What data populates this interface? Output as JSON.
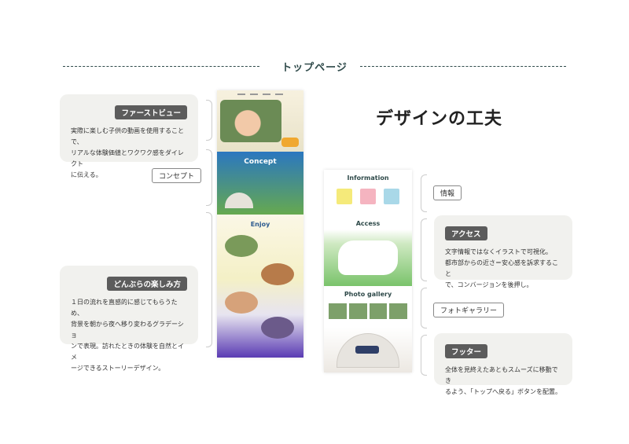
{
  "header": {
    "title": "トップページ"
  },
  "design_title": "デザインの工夫",
  "sections": {
    "first_view": {
      "tag": "ファーストビュー",
      "desc": [
        "実際に楽しむ子供の動画を使用することで、",
        "リアルな体験価値とワクワク感をダイレクト",
        "に伝える。"
      ]
    },
    "concept": {
      "tag": "コンセプト"
    },
    "enjoy": {
      "tag": "どんぶらの楽しみ方",
      "desc": [
        "１日の流れを直感的に感じてもらうため、",
        "背景を朝から夜へ移り変わるグラデーショ",
        "ンで表現。訪れたときの体験を自然とイメ",
        "ージできるストーリーデザイン。"
      ]
    },
    "info": {
      "tag": "情報"
    },
    "access": {
      "tag": "アクセス",
      "desc": [
        "文字情報ではなくイラストで可視化。",
        "都市部からの近さ＝安心感を訴求すること",
        "で、コンバージョンを後押し。"
      ]
    },
    "gallery": {
      "tag": "フォトギャラリー"
    },
    "footer": {
      "tag": "フッター",
      "desc": [
        "全体を見終えたあともスムーズに移動でき",
        "るよう、「トップへ戻る」ボタンを配置。"
      ]
    }
  },
  "mockup": {
    "concept_label": "Concept",
    "enjoy_label": "Enjoy",
    "info_label": "Information",
    "access_label": "Access",
    "gallery_label": "Photo gallery"
  },
  "colors": {
    "dark_teal": "#2f4a4a",
    "tag_bg": "#5c5c5c",
    "card_bg": "#f1f1ee"
  }
}
